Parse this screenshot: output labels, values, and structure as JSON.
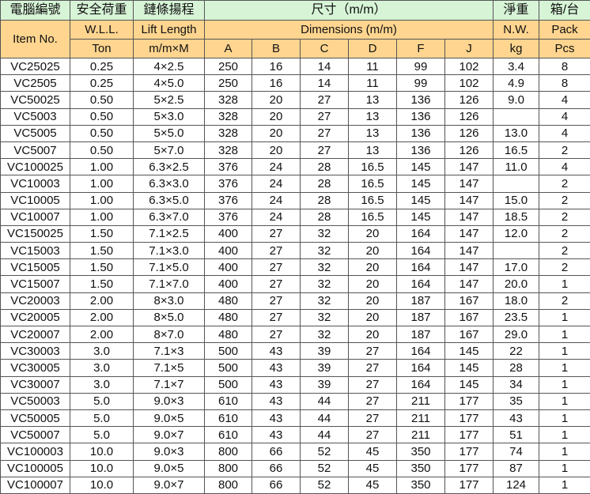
{
  "header": {
    "cn": [
      "電腦編號",
      "安全荷重",
      "鏈條揚程",
      "尺寸（m/m）",
      "淨重",
      "箱/台"
    ],
    "item_no": "Item No.",
    "wll_line1": "W.L.L.",
    "wll_line2": "Ton",
    "lift_line1": "Lift Length",
    "lift_line2": "m/m×M",
    "dimensions": "Dimensions (m/m)",
    "dim_cols": [
      "A",
      "B",
      "C",
      "D",
      "F",
      "J"
    ],
    "nw_line1": "N.W.",
    "nw_line2": "kg",
    "pack_line1": "Pack",
    "pack_line2": "Pcs"
  },
  "rows": [
    [
      "VC25025",
      "0.25",
      "4×2.5",
      "250",
      "16",
      "14",
      "11",
      "99",
      "102",
      "3.4",
      "8"
    ],
    [
      "VC2505",
      "0.25",
      "4×5.0",
      "250",
      "16",
      "14",
      "11",
      "99",
      "102",
      "4.9",
      "8"
    ],
    [
      "VC50025",
      "0.50",
      "5×2.5",
      "328",
      "20",
      "27",
      "13",
      "136",
      "126",
      "9.0",
      "4"
    ],
    [
      "VC5003",
      "0.50",
      "5×3.0",
      "328",
      "20",
      "27",
      "13",
      "136",
      "126",
      "",
      "4"
    ],
    [
      "VC5005",
      "0.50",
      "5×5.0",
      "328",
      "20",
      "27",
      "13",
      "136",
      "126",
      "13.0",
      "4"
    ],
    [
      "VC5007",
      "0.50",
      "5×7.0",
      "328",
      "20",
      "27",
      "13",
      "136",
      "126",
      "16.5",
      "2"
    ],
    [
      "VC100025",
      "1.00",
      "6.3×2.5",
      "376",
      "24",
      "28",
      "16.5",
      "145",
      "147",
      "11.0",
      "4"
    ],
    [
      "VC10003",
      "1.00",
      "6.3×3.0",
      "376",
      "24",
      "28",
      "16.5",
      "145",
      "147",
      "",
      "2"
    ],
    [
      "VC10005",
      "1.00",
      "6.3×5.0",
      "376",
      "24",
      "28",
      "16.5",
      "145",
      "147",
      "15.0",
      "2"
    ],
    [
      "VC10007",
      "1.00",
      "6.3×7.0",
      "376",
      "24",
      "28",
      "16.5",
      "145",
      "147",
      "18.5",
      "2"
    ],
    [
      "VC150025",
      "1.50",
      "7.1×2.5",
      "400",
      "27",
      "32",
      "20",
      "164",
      "147",
      "12.0",
      "2"
    ],
    [
      "VC15003",
      "1.50",
      "7.1×3.0",
      "400",
      "27",
      "32",
      "20",
      "164",
      "147",
      "",
      "2"
    ],
    [
      "VC15005",
      "1.50",
      "7.1×5.0",
      "400",
      "27",
      "32",
      "20",
      "164",
      "147",
      "17.0",
      "2"
    ],
    [
      "VC15007",
      "1.50",
      "7.1×7.0",
      "400",
      "27",
      "32",
      "20",
      "164",
      "147",
      "20.0",
      "1"
    ],
    [
      "VC20003",
      "2.00",
      "8×3.0",
      "480",
      "27",
      "32",
      "20",
      "187",
      "167",
      "18.0",
      "2"
    ],
    [
      "VC20005",
      "2.00",
      "8×5.0",
      "480",
      "27",
      "32",
      "20",
      "187",
      "167",
      "23.5",
      "1"
    ],
    [
      "VC20007",
      "2.00",
      "8×7.0",
      "480",
      "27",
      "32",
      "20",
      "187",
      "167",
      "29.0",
      "1"
    ],
    [
      "VC30003",
      "3.0",
      "7.1×3",
      "500",
      "43",
      "39",
      "27",
      "164",
      "145",
      "22",
      "1"
    ],
    [
      "VC30005",
      "3.0",
      "7.1×5",
      "500",
      "43",
      "39",
      "27",
      "164",
      "145",
      "28",
      "1"
    ],
    [
      "VC30007",
      "3.0",
      "7.1×7",
      "500",
      "43",
      "39",
      "27",
      "164",
      "145",
      "34",
      "1"
    ],
    [
      "VC50003",
      "5.0",
      "9.0×3",
      "610",
      "43",
      "44",
      "27",
      "211",
      "177",
      "35",
      "1"
    ],
    [
      "VC50005",
      "5.0",
      "9.0×5",
      "610",
      "43",
      "44",
      "27",
      "211",
      "177",
      "43",
      "1"
    ],
    [
      "VC50007",
      "5.0",
      "9.0×7",
      "610",
      "43",
      "44",
      "27",
      "211",
      "177",
      "51",
      "1"
    ],
    [
      "VC100003",
      "10.0",
      "9.0×3",
      "800",
      "66",
      "52",
      "45",
      "350",
      "177",
      "74",
      "1"
    ],
    [
      "VC100005",
      "10.0",
      "9.0×5",
      "800",
      "66",
      "52",
      "45",
      "350",
      "177",
      "87",
      "1"
    ],
    [
      "VC100007",
      "10.0",
      "9.0×7",
      "800",
      "66",
      "52",
      "45",
      "350",
      "177",
      "124",
      "1"
    ]
  ]
}
